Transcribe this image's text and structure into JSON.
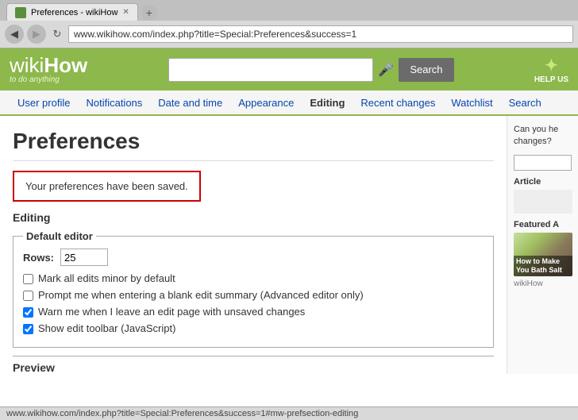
{
  "browser": {
    "tab_title": "Preferences - wikiHow",
    "url": "www.wikihow.com/index.php?title=Special:Preferences&success=1",
    "back_btn": "◀",
    "forward_btn": "▶",
    "refresh_btn": "↻"
  },
  "header": {
    "logo_wiki": "wiki",
    "logo_how": "How",
    "logo_subtitle": "to do anything",
    "search_placeholder": "",
    "search_button": "Search",
    "help_us_label": "HELP US"
  },
  "nav": {
    "items": [
      {
        "label": "User profile",
        "active": false
      },
      {
        "label": "Notifications",
        "active": false
      },
      {
        "label": "Date and time",
        "active": false
      },
      {
        "label": "Appearance",
        "active": false
      },
      {
        "label": "Editing",
        "active": true
      },
      {
        "label": "Recent changes",
        "active": false
      },
      {
        "label": "Watchlist",
        "active": false
      },
      {
        "label": "Search",
        "active": false
      }
    ]
  },
  "main": {
    "page_title": "Preferences",
    "success_message": "Your preferences have been saved.",
    "section_heading": "Editing",
    "default_editor": {
      "legend": "Default editor",
      "rows_label": "Rows:",
      "rows_value": "25"
    },
    "checkboxes": [
      {
        "label": "Mark all edits minor by default",
        "checked": false
      },
      {
        "label": "Prompt me when entering a blank edit summary (Advanced editor only)",
        "checked": false
      },
      {
        "label": "Warn me when I leave an edit page with unsaved changes",
        "checked": true
      },
      {
        "label": "Show edit toolbar (JavaScript)",
        "checked": true
      }
    ],
    "preview_label": "Preview"
  },
  "sidebar": {
    "question_text": "Can you he changes?",
    "article_label": "Article",
    "featured_label": "Featured A",
    "featured_img_text": "How to Make You Bath Salt"
  },
  "statusbar": {
    "text": "www.wikihow.com/index.php?title=Special:Preferences&success=1#mw-prefsection-editing"
  }
}
